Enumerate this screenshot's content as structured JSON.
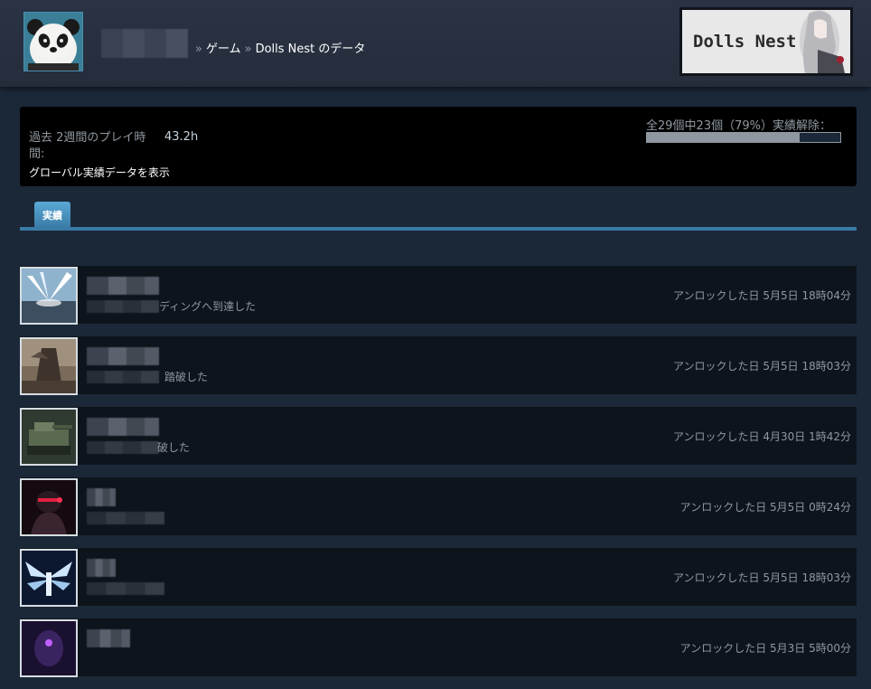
{
  "header": {
    "breadcrumb_sep": "»",
    "crumb_games": "ゲーム",
    "crumb_game_stats": "Dolls Nest のデータ",
    "game_logo_text": "Dolls Nest"
  },
  "stats": {
    "playtime_label": "過去 2週間のプレイ時間:",
    "playtime_value": "43.2h",
    "global_link": "グローバル実績データを表示",
    "progress_text": "全29個中23個（79%）実績解除：",
    "progress_fraction": 0.79
  },
  "tabs": [
    {
      "label": "実績"
    }
  ],
  "achievements": [
    {
      "desc_tail": "ディングへ到達した",
      "unlock": "アンロックした日 5月5日 18時04分",
      "icon": "light-burst-icon"
    },
    {
      "desc_tail": "踏破した",
      "unlock": "アンロックした日 5月5日 18時03分",
      "icon": "ruins-tower-icon"
    },
    {
      "desc_tail": "破した",
      "unlock": "アンロックした日 4月30日 1時42分",
      "icon": "mech-tank-icon"
    },
    {
      "desc_tail": "",
      "unlock": "アンロックした日 5月5日 0時24分",
      "icon": "red-visor-robot-icon"
    },
    {
      "desc_tail": "",
      "unlock": "アンロックした日 5月5日 18時03分",
      "icon": "winged-angel-icon"
    },
    {
      "desc_tail": "",
      "unlock": "アンロックした日 5月3日 5時00分",
      "icon": "purple-mech-icon"
    }
  ]
}
